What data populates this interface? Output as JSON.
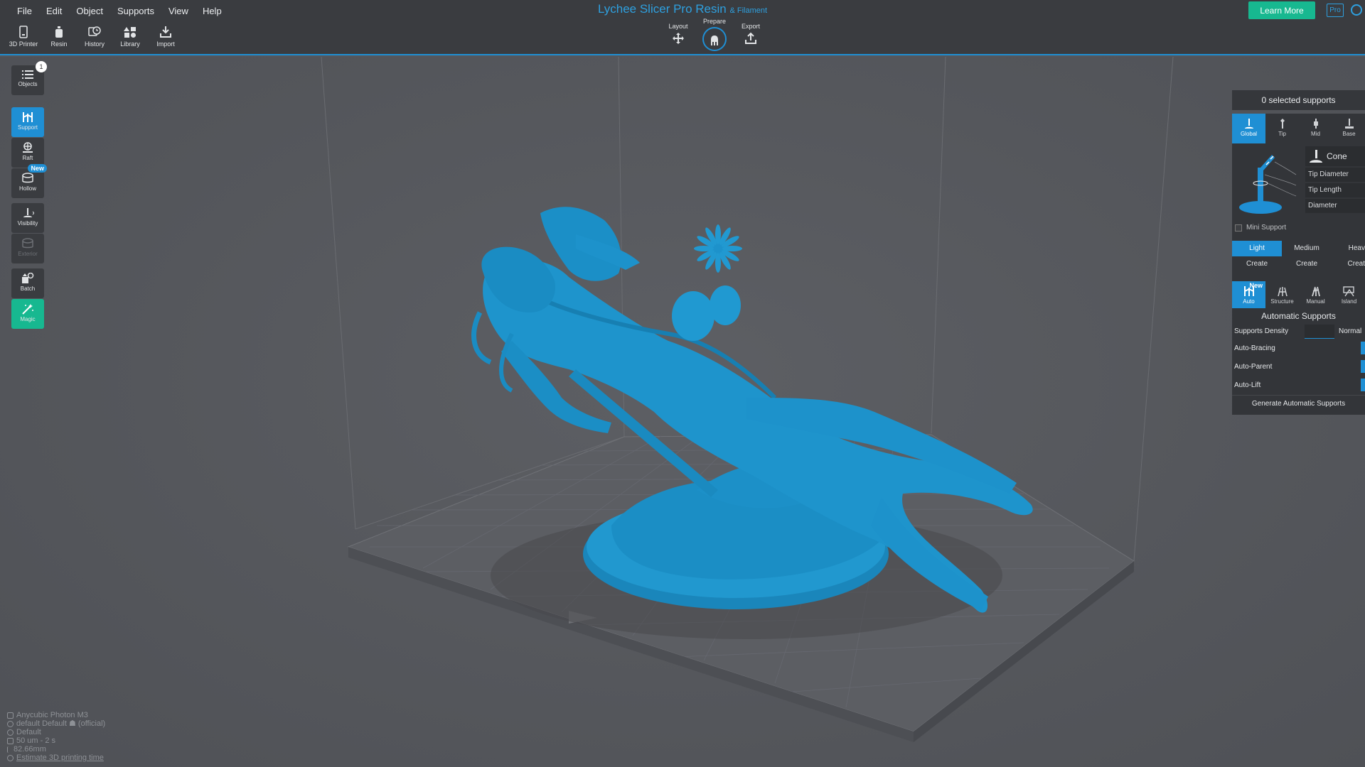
{
  "menu": [
    "File",
    "Edit",
    "Object",
    "Supports",
    "View",
    "Help"
  ],
  "app": {
    "title": "Lychee Slicer Pro Resin",
    "subtitle": "& Filament",
    "learn_more": "Learn More",
    "pro": "Pro"
  },
  "toolbar": {
    "printer": "3D Printer",
    "resin": "Resin",
    "history": "History",
    "library": "Library",
    "import": "Import"
  },
  "stages": {
    "layout": "Layout",
    "prepare": "Prepare",
    "export": "Export"
  },
  "sidebar": {
    "objects": "Objects",
    "objects_count": "1",
    "support": "Support",
    "raft": "Raft",
    "hollow": "Hollow",
    "hollow_badge": "New",
    "visibility": "Visibility",
    "exterior": "Exterior",
    "batch": "Batch",
    "magic": "Magic"
  },
  "panel": {
    "selected_supports": "0 selected supports",
    "tabs": [
      "Global",
      "Tip",
      "Mid",
      "Base"
    ],
    "shape": "Cone",
    "params": [
      "Tip Diameter",
      "Tip Length",
      "Diameter"
    ],
    "mini_support": "Mini Support",
    "presets": [
      "Light",
      "Medium",
      "Heav"
    ],
    "create": [
      "Create",
      "Create",
      "Creat"
    ],
    "mode_tabs": [
      "Auto",
      "Structure",
      "Manual",
      "Island"
    ],
    "mode_new_badge": "New",
    "auto_title": "Automatic Supports",
    "density_label": "Supports Density",
    "density_value": "Normal",
    "auto_bracing": "Auto-Bracing",
    "auto_parent": "Auto-Parent",
    "auto_lift": "Auto-Lift",
    "generate": "Generate Automatic Supports"
  },
  "status": {
    "printer": "Anycubic Photon M3",
    "profile": "default Default ☗ (official)",
    "resin": "Default",
    "layer": "50 um - 2 s",
    "height": "82.66mm",
    "estimate": "Estimate 3D printing time"
  },
  "colors": {
    "accent": "#1f8fd4",
    "model": "#1e94cc",
    "green": "#17b890"
  }
}
